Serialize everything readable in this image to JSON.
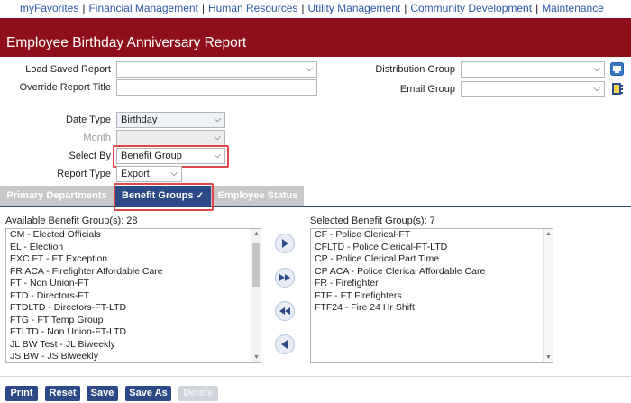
{
  "nav": {
    "items": [
      "myFavorites",
      "Financial Management",
      "Human Resources",
      "Utility Management",
      "Community Development",
      "Maintenance"
    ],
    "separator": "|"
  },
  "page": {
    "title": "Employee Birthday Anniversary Report"
  },
  "form": {
    "load_saved_report": {
      "label": "Load Saved Report",
      "value": ""
    },
    "override_report_title": {
      "label": "Override Report Title",
      "value": ""
    },
    "distribution_group": {
      "label": "Distribution Group",
      "value": ""
    },
    "email_group": {
      "label": "Email Group",
      "value": ""
    },
    "date_type": {
      "label": "Date Type",
      "value": "Birthday"
    },
    "month": {
      "label": "Month",
      "value": ""
    },
    "select_by": {
      "label": "Select By",
      "value": "Benefit Group"
    },
    "report_type": {
      "label": "Report Type",
      "value": "Export"
    }
  },
  "tabs": [
    {
      "label": "Primary Departments",
      "active": false
    },
    {
      "label": "Benefit Groups",
      "active": true,
      "check": "✓"
    },
    {
      "label": "Employee Status",
      "active": false
    }
  ],
  "available": {
    "label": "Available Benefit Group(s): 28",
    "items": [
      "CM - Elected Officials",
      "EL - Election",
      "EXC FT - FT Exception",
      "FR ACA - Firefighter Affordable Care",
      "FT - Non Union-FT",
      "FTD - Directors-FT",
      "FTDLTD - Directors-FT-LTD",
      "FTG - FT Temp Group",
      "FTLTD - Non Union-FT-LTD",
      "JL BW Test - JL Biweekly",
      "JS BW - JS Biweekly"
    ]
  },
  "selected": {
    "label": "Selected Benefit Group(s): 7",
    "items": [
      "CF - Police Clerical-FT",
      "CFLTD - Police Clerical-FT-LTD",
      "CP - Police Clerical Part Time",
      "CP ACA - Police Clerical Affordable Care",
      "FR - Firefighter",
      "FTF - FT Firefighters",
      "FTF24 - Fire 24 Hr Shift"
    ]
  },
  "buttons": {
    "print": "Print",
    "reset": "Reset",
    "save": "Save",
    "save_as": "Save As",
    "delete": "Delete"
  },
  "colors": {
    "title_bar": "#8f0e1c",
    "primary": "#2d4a86",
    "link": "#2a58a6",
    "highlight": "#e04848"
  }
}
